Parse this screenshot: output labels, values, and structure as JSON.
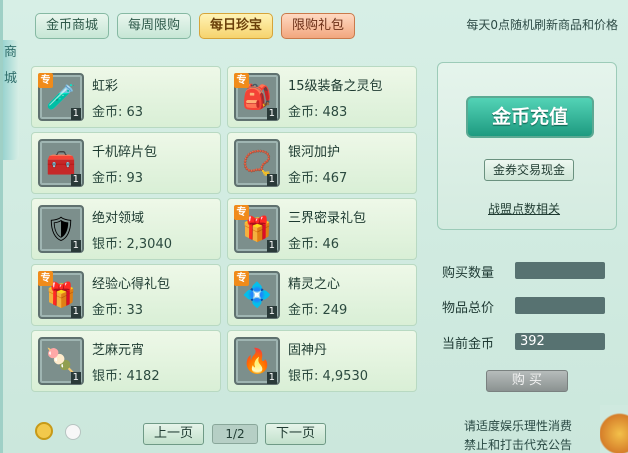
{
  "tabs": [
    {
      "label": "金币商城",
      "active": false
    },
    {
      "label": "每周限购",
      "active": false
    },
    {
      "label": "每日珍宝",
      "active": true
    },
    {
      "label": "限购礼包",
      "active": false
    }
  ],
  "side_labels": [
    "商",
    "城"
  ],
  "refresh_notice": "每天0点随机刷新商品和价格",
  "items": [
    {
      "name": "虹彩",
      "price": "金币: 63",
      "exclusive": true,
      "qty": "1",
      "icon": "perfume-bottle-icon",
      "glyph": "🧪"
    },
    {
      "name": "15级装备之灵包",
      "price": "金币: 483",
      "exclusive": true,
      "qty": "1",
      "icon": "equipment-spirit-pack-icon",
      "glyph": "🎒"
    },
    {
      "name": "千机碎片包",
      "price": "金币: 93",
      "exclusive": false,
      "qty": "1",
      "icon": "fragment-pack-icon",
      "glyph": "🧰"
    },
    {
      "name": "银河加护",
      "price": "金币: 467",
      "exclusive": false,
      "qty": "1",
      "icon": "necklace-icon",
      "glyph": "📿"
    },
    {
      "name": "绝对领域",
      "price": "银币: 2,3040",
      "exclusive": false,
      "qty": "1",
      "icon": "armor-icon",
      "glyph": "🛡"
    },
    {
      "name": "三界密录礼包",
      "price": "金币: 46",
      "exclusive": true,
      "qty": "1",
      "icon": "gift-bag-icon",
      "glyph": "🎁"
    },
    {
      "name": "经验心得礼包",
      "price": "金币: 33",
      "exclusive": true,
      "qty": "1",
      "icon": "experience-gift-bag-icon",
      "glyph": "🎁"
    },
    {
      "name": "精灵之心",
      "price": "金币: 249",
      "exclusive": true,
      "qty": "1",
      "icon": "spirit-heart-icon",
      "glyph": "💠"
    },
    {
      "name": "芝麻元宵",
      "price": "银币: 4182",
      "exclusive": false,
      "qty": "1",
      "icon": "rice-dumpling-icon",
      "glyph": "🍡"
    },
    {
      "name": "固神丹",
      "price": "银币: 4,9530",
      "exclusive": false,
      "qty": "1",
      "icon": "elixir-icon",
      "glyph": "🔥"
    }
  ],
  "exclusive_badge": "专",
  "pagination": {
    "prev": "上一页",
    "indicator": "1/2",
    "next": "下一页"
  },
  "recharge_label": "金币充值",
  "trade_label": "金券交易现金",
  "points_link": "战盟点数相关",
  "form": {
    "qty_label": "购买数量",
    "qty_value": "",
    "total_label": "物品总价",
    "total_value": "",
    "gold_label": "当前金币",
    "gold_value": "392"
  },
  "buy_label": "购 买",
  "disclaimer": [
    "请适度娱乐理性消费",
    "禁止和打击代充公告"
  ],
  "colors": {
    "accent": "#2aa88a",
    "active_tab": "#f6d36d",
    "exclusive_badge": "#f08b1a"
  }
}
